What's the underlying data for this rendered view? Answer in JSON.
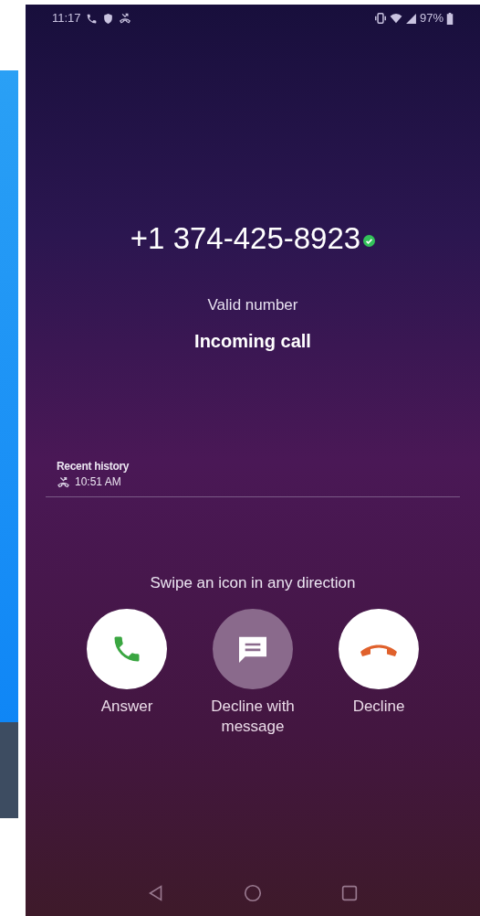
{
  "status_bar": {
    "time": "11:17",
    "battery": "97%"
  },
  "caller": {
    "number": "+1 374-425-8923",
    "verified": true,
    "note": "Valid number",
    "status": "Incoming call"
  },
  "recent_history": {
    "title": "Recent history",
    "time": "10:51 AM"
  },
  "hint": "Swipe an icon in any direction",
  "actions": [
    {
      "kind": "answer",
      "label": "Answer"
    },
    {
      "kind": "message",
      "label": "Decline with message"
    },
    {
      "kind": "decline",
      "label": "Decline"
    }
  ]
}
